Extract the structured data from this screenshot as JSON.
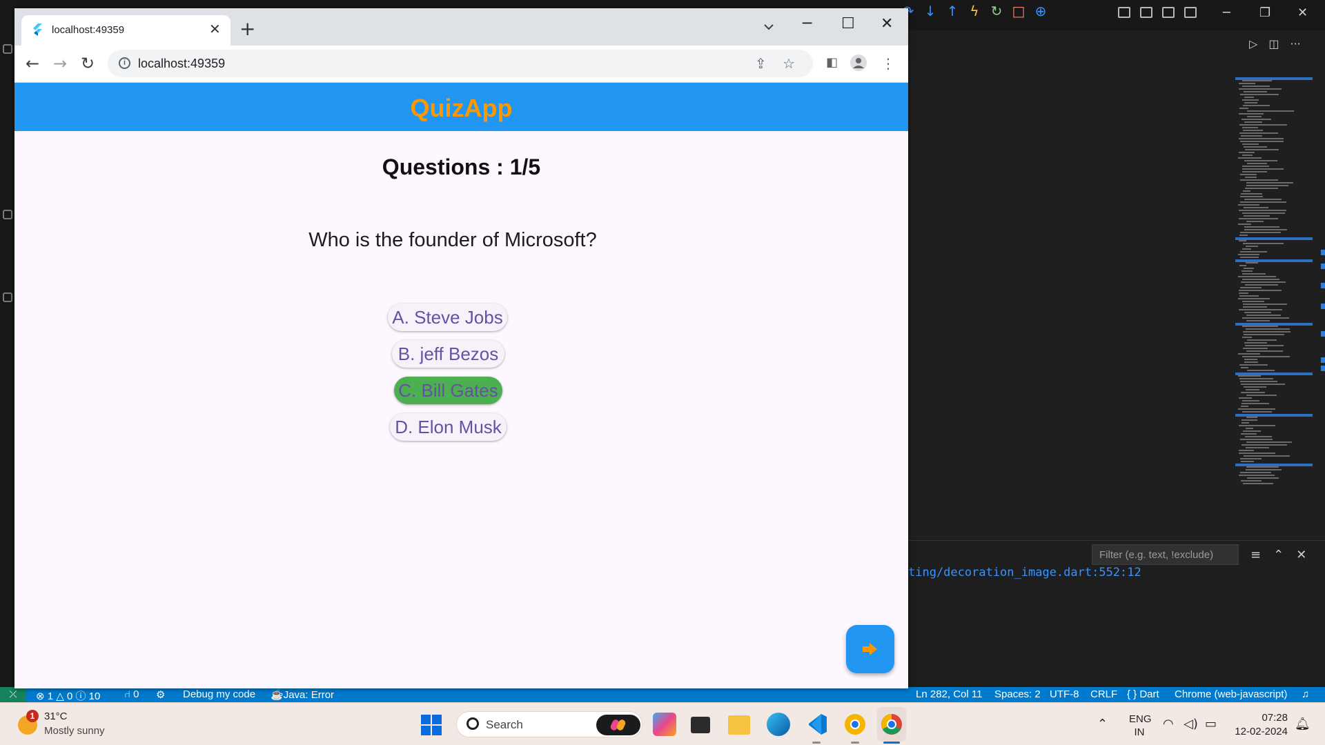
{
  "browser": {
    "tab_title": "localhost:49359",
    "url": "localhost:49359"
  },
  "app": {
    "title": "QuizApp",
    "question_counter": "Questions : 1/5",
    "question": "Who is the founder of Microsoft?",
    "options": [
      {
        "label": "A. Steve Jobs",
        "selected": false
      },
      {
        "label": "B. jeff Bezos",
        "selected": false
      },
      {
        "label": "C. Bill Gates",
        "selected": true
      },
      {
        "label": "D. Elon Musk",
        "selected": false
      }
    ],
    "colors": {
      "appbar": "#2196f3",
      "title": "#ff9800",
      "selected_option": "#4caf50",
      "option_text": "#6750a4"
    }
  },
  "vscode": {
    "filter_placeholder": "Filter (e.g. text, !exclude)",
    "console_line": "ting/decoration_image.dart:552:12",
    "statusbar": {
      "problems": "⊗ 1 △ 0 ⓘ 10",
      "ports": "⑁ 0",
      "debug": "Debug my code",
      "java": "Java: Error",
      "position": "Ln 282, Col 11",
      "spaces": "Spaces: 2",
      "encoding": "UTF-8",
      "eol": "CRLF",
      "language": "{ } Dart",
      "device": "Chrome (web-javascript)"
    }
  },
  "taskbar": {
    "weather_badge": "1",
    "temperature": "31°C",
    "weather": "Mostly sunny",
    "search_label": "Search",
    "lang_line1": "ENG",
    "lang_line2": "IN",
    "time": "07:28",
    "date": "12-02-2024"
  }
}
